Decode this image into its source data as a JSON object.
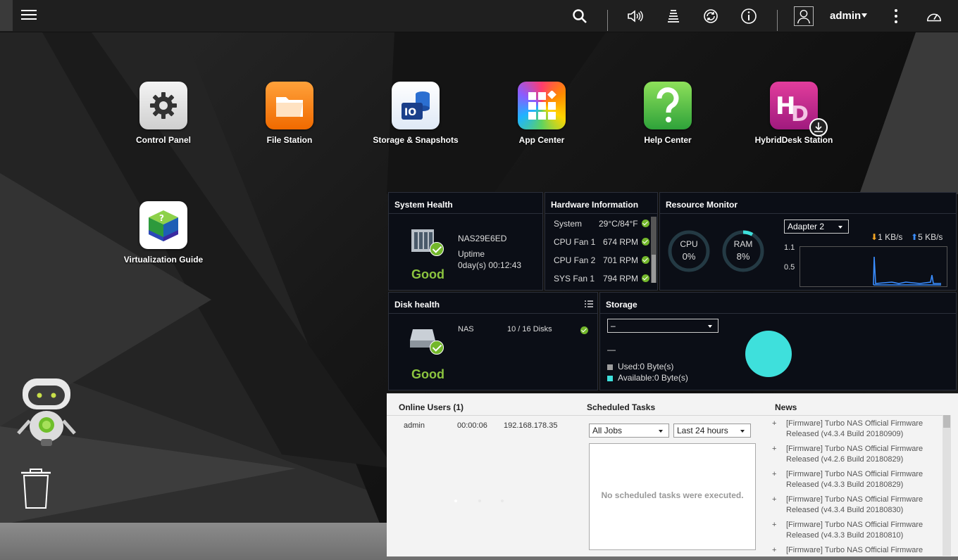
{
  "topbar": {
    "user": "admin",
    "icons": [
      "menu-icon",
      "search-icon",
      "volume-icon",
      "tasks-icon",
      "sync-icon",
      "info-icon",
      "user-icon",
      "more-icon",
      "dashboard-gauge-icon"
    ]
  },
  "apps": [
    {
      "label": "Control Panel",
      "icon": "gear-icon"
    },
    {
      "label": "File Station",
      "icon": "folder-icon"
    },
    {
      "label": "Storage & Snapshots",
      "icon": "storage-icon"
    },
    {
      "label": "App Center",
      "icon": "app-grid-icon"
    },
    {
      "label": "Help Center",
      "icon": "question-icon"
    },
    {
      "label": "HybridDesk Station",
      "icon": "hd-icon"
    },
    {
      "label": "Virtualization Guide",
      "icon": "cube-icon"
    }
  ],
  "system_health": {
    "title": "System Health",
    "name": "NAS29E6ED",
    "uptime_label": "Uptime",
    "uptime": "0day(s) 00:12:43",
    "status": "Good"
  },
  "hardware": {
    "title": "Hardware Information",
    "rows": [
      {
        "label": "System",
        "value": "29°C/84°F"
      },
      {
        "label": "CPU Fan 1",
        "value": "674 RPM"
      },
      {
        "label": "CPU Fan 2",
        "value": "701 RPM"
      },
      {
        "label": "SYS Fan 1",
        "value": "794 RPM"
      }
    ]
  },
  "resource": {
    "title": "Resource Monitor",
    "cpu_label": "CPU",
    "cpu_value": "0%",
    "cpu_fraction": 0.0,
    "ram_label": "RAM",
    "ram_value": "8%",
    "ram_fraction": 0.08,
    "adapter": "Adapter 2",
    "down": "1 KB/s",
    "up": "5 KB/s",
    "y_top": "1.1",
    "y_mid": "0.5"
  },
  "disk_health": {
    "title": "Disk health",
    "name": "NAS",
    "disks": "10 / 16 Disks",
    "status": "Good"
  },
  "storage": {
    "title": "Storage",
    "selected": "–",
    "volume": "—",
    "used": "Used:0 Byte(s)",
    "available": "Available:0 Byte(s)",
    "used_color": "#9e9e9e",
    "available_color": "#3ee0dc"
  },
  "online_users": {
    "title": "Online Users (1)",
    "rows": [
      {
        "user": "admin",
        "time": "00:00:06",
        "ip": "192.168.178.35"
      }
    ]
  },
  "scheduled": {
    "title": "Scheduled Tasks",
    "filter1": "All Jobs",
    "filter2": "Last 24 hours",
    "empty": "No scheduled tasks were executed."
  },
  "news": {
    "title": "News",
    "items": [
      "[Firmware] Turbo NAS Official Firmware Released (v4.3.4 Build 20180909)",
      "[Firmware] Turbo NAS Official Firmware Released (v4.2.6 Build 20180829)",
      "[Firmware] Turbo NAS Official Firmware Released (v4.3.3 Build 20180829)",
      "[Firmware] Turbo NAS Official Firmware Released (v4.3.4 Build 20180830)",
      "[Firmware] Turbo NAS Official Firmware Released (v4.3.3 Build 20180810)",
      "[Firmware] Turbo NAS Official Firmware"
    ]
  },
  "colors": {
    "good": "#8cc43f",
    "accent_teal": "#3ee0dc",
    "panel_bg": "#0b0e16"
  }
}
